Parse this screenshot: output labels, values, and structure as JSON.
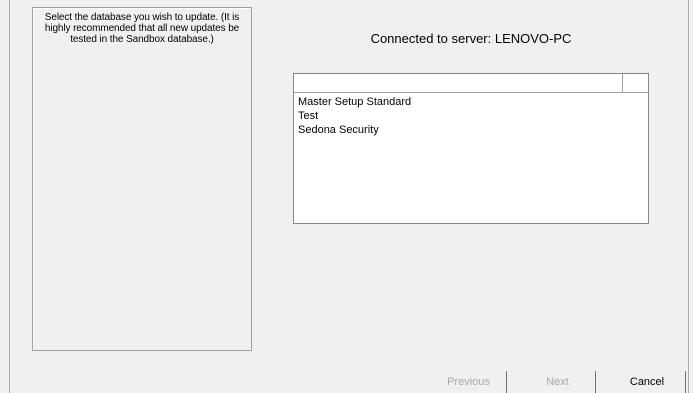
{
  "instructions": {
    "text": "Select the database you wish to update. (It is highly recommended that all new updates be tested in the Sandbox database.)"
  },
  "server": {
    "label": "Connected to server: LENOVO-PC"
  },
  "database_list": {
    "items": [
      {
        "label": "Master Setup Standard"
      },
      {
        "label": "Test"
      },
      {
        "label": "Sedona Security"
      }
    ]
  },
  "buttons": {
    "previous": "Previous",
    "next": "Next",
    "cancel": "Cancel"
  }
}
